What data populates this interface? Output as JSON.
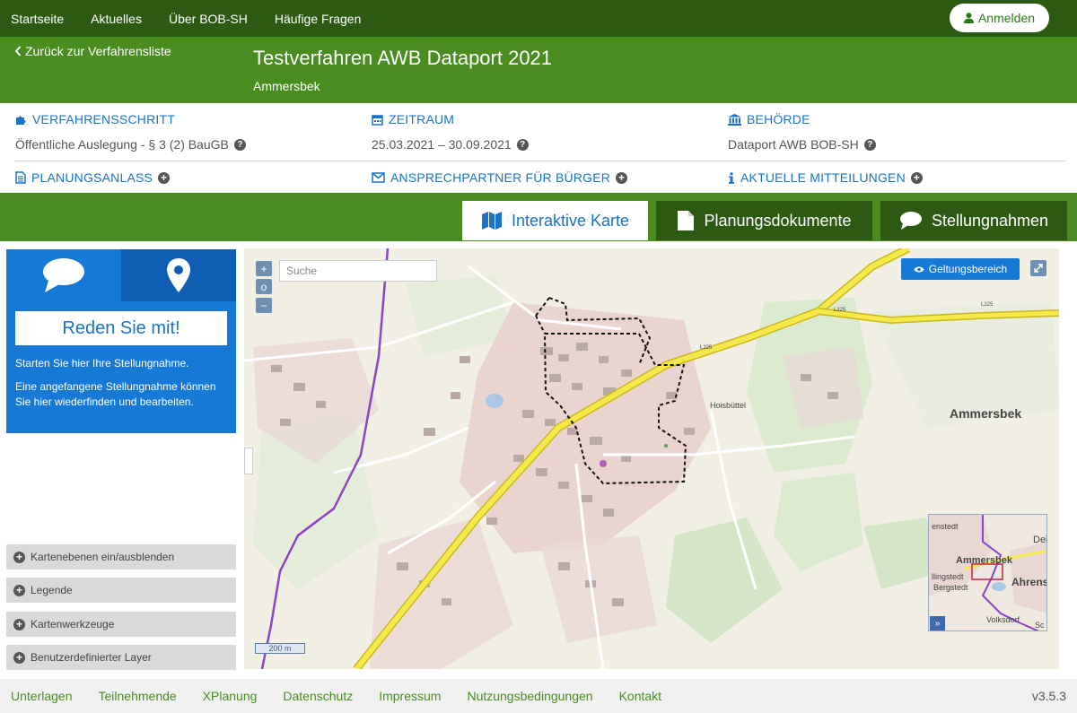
{
  "topnav": {
    "items": [
      "Startseite",
      "Aktuelles",
      "Über BOB-SH",
      "Häufige Fragen"
    ],
    "login_label": "Anmelden"
  },
  "header": {
    "back_label": "Zurück zur Verfahrensliste",
    "title": "Testverfahren AWB Dataport 2021",
    "subtitle": "Ammersbek"
  },
  "info": {
    "step_label": "VERFAHRENSSCHRITT",
    "step_value": "Öffentliche Auslegung - § 3 (2) BauGB",
    "period_label": "ZEITRAUM",
    "period_value": "25.03.2021 – 30.09.2021",
    "authority_label": "BEHÖRDE",
    "authority_value": "Dataport AWB BOB-SH",
    "reason_label": "PLANUNGSANLASS",
    "contact_label": "ANSPRECHPARTNER FÜR BÜRGER",
    "news_label": "AKTUELLE MITTEILUNGEN"
  },
  "tabs": [
    "Interaktive Karte",
    "Planungsdokumente",
    "Stellungnahmen"
  ],
  "panel": {
    "talk_button": "Reden Sie mit!",
    "text1": "Starten Sie hier Ihre Stellungnahme.",
    "text2": "Eine angefangene Stellungnahme können Sie hier wiederfinden und bearbeiten.",
    "accordion": [
      "Kartenebenen ein/ausblenden",
      "Legende",
      "Kartenwerkzeuge",
      "Benutzerdefinierter Layer"
    ]
  },
  "map": {
    "search_placeholder": "Suche",
    "zoom_in": "+",
    "zoom_reset": "o",
    "zoom_out": "−",
    "geltung_label": "Geltungsbereich",
    "scale_label": "200 m",
    "labels": {
      "ammersbek": "Ammersbek",
      "hoisbuettel": "Hoisbüttel",
      "l225a": "L225",
      "l225b": "L225",
      "l225c": "L225"
    },
    "overview": {
      "delingsdorf": "Deli",
      "ammersbek": "Ammersbek",
      "ahrensburg": "Ahrens",
      "bargteheide": "enstedt",
      "bergstedt": "Bergstedt",
      "lemsahl": "llingstedt",
      "volksdorf": "Volksdorf",
      "sc": "Sc",
      "toggle": "»"
    }
  },
  "footer": {
    "links": [
      "Unterlagen",
      "Teilnehmende",
      "XPlanung",
      "Datenschutz",
      "Impressum",
      "Nutzungsbedingungen",
      "Kontakt"
    ],
    "version": "v3.5.3"
  },
  "colors": {
    "dark_green": "#2d5a12",
    "green": "#4a8c20",
    "blue": "#1779d6",
    "road_yellow": "#f5e84a",
    "boundary_purple": "#8a44c8"
  }
}
